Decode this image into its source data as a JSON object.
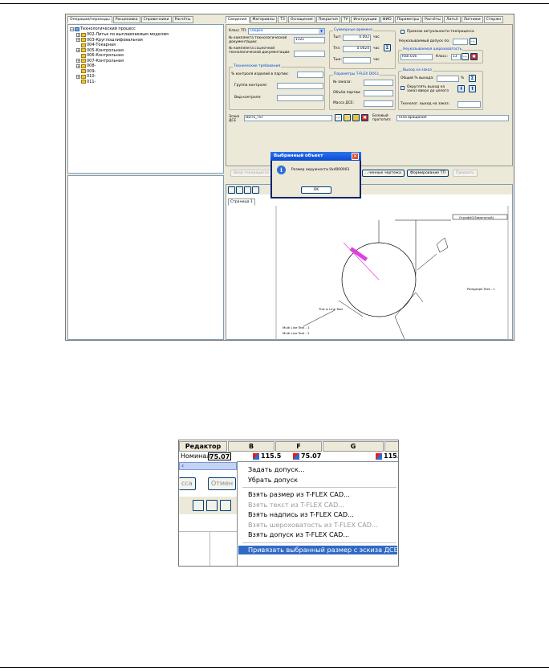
{
  "top_tabs": [
    "Операции/переходы",
    "Расцеховка",
    "Справочники",
    "Расчёты"
  ],
  "tree": {
    "root": "Технологический процесс",
    "items": [
      {
        "label": "002-Литье по выплавляемым моделям",
        "plus": true
      },
      {
        "label": "003-Круглошлифовальная",
        "plus": true
      },
      {
        "label": "004-Токарная",
        "plus": false
      },
      {
        "label": "005-Контрольная",
        "plus": true
      },
      {
        "label": "006-Контрольная",
        "plus": false
      },
      {
        "label": "007-Контрольная",
        "plus": true
      },
      {
        "label": "008-",
        "plus": true
      },
      {
        "label": "009-",
        "plus": false
      },
      {
        "label": "010-",
        "plus": true
      },
      {
        "label": "011-",
        "plus": false
      }
    ]
  },
  "right_tabs": [
    "Сведения",
    "Материалы",
    "ТЗ",
    "Оснащение",
    "Покрытия",
    "ТУ",
    "Инструкции",
    "ФИО",
    "Параметры",
    "Расчёты",
    "Литьё",
    "Литники",
    "Стержн"
  ],
  "form": {
    "class_tp_label": "Класс ТП:",
    "class_tp_value": "Сборка",
    "kit_label": "№ комплекта технологической документации:",
    "kit_value": "1121",
    "ref_kit_label": "№ комплекта ссылочной технологической документации:",
    "tech_req_title": "Технические требования",
    "control_pct_label": "% контроля изделий в партии:",
    "control_group_label": "Группа контроля:",
    "control_type_label": "Вид контроля:",
    "sum_time_title": "Суммарные времена",
    "tsht_label": "Тшт:",
    "tsht_value": "0.002",
    "tsht_unit": "час",
    "tpz_label": "Тпз:",
    "tpz_value": "0.0024",
    "tpz_unit": "час",
    "tshk_label": "Тшк:",
    "tshk_unit": "час",
    "params_title": "Параметры T-FLEX DOCs",
    "order_label": "№ заказа:",
    "batch_label": "Объём партии:",
    "mass_label": "Масса ДСЕ:",
    "relevance_label": "Признак актуальности техпроцесса",
    "tolerance_label": "Неуказываемый допуск по:",
    "roughness_title": "Неуказываемая шероховатость",
    "roughness_value": "Ra0.016",
    "class_label": "Класс:",
    "class_value": "13",
    "output_title": "Выход на заказ",
    "total_pct_label": "Общий % выхода:",
    "pct_unit": "%",
    "round_label": "Округлять выход на заказ вверх до целого",
    "techn_output_label": "Технолог. выход на заказ:",
    "sketch_label": "Эскиз ДСЕ",
    "sketch_value": "DDTk_TST",
    "proto_label": "Базовый прототип:",
    "proto_value": "Тела вращения"
  },
  "bottom_buttons": {
    "enter": "Ввод техпроцесса",
    "drawing": "...ченные чертежа",
    "form_tp": "Формирование ТП",
    "interrupt": "Прервать"
  },
  "page_tab": "Страница 1",
  "drawing_labels": {
    "paragraph": "Paragraph Text - 1",
    "line_text": "This is Line Text",
    "multi1": "Multi Line Text - 1",
    "multi2": "Multi Line Text - 2",
    "note": "Ограф40(Замкнутый)"
  },
  "dialog": {
    "title": "Выбранный объект",
    "message": "Размер окружности 0x4000003",
    "ok": "OK"
  },
  "editor": {
    "header": "Редактор",
    "columns": [
      "B",
      "F",
      "G"
    ],
    "row_label": "Номинал",
    "values": [
      "75.07",
      "115.5",
      "75.07",
      "115."
    ],
    "side_btn_cancel": "Отмен",
    "side_btn_process": "сса"
  },
  "context_menu": [
    {
      "label": "Задать допуск...",
      "disabled": false
    },
    {
      "label": "Убрать допуск",
      "disabled": false
    },
    {
      "sep": true
    },
    {
      "label": "Взять размер из T-FLEX CAD...",
      "disabled": false
    },
    {
      "label": "Взять текст из T-FLEX CAD...",
      "disabled": true
    },
    {
      "label": "Взять надпись из T-FLEX CAD...",
      "disabled": false
    },
    {
      "label": "Взять шероховатость из T-FLEX CAD...",
      "disabled": true
    },
    {
      "label": "Взять допуск из T-FLEX CAD...",
      "disabled": false
    },
    {
      "sep": true
    },
    {
      "label": "Привязать выбранный размер с эскиза ДСЕ",
      "disabled": false,
      "highlighted": true
    }
  ],
  "colors": {
    "highlight": "#316ac5",
    "titlebar": "#0a4bd0",
    "magenta": "#e040e0"
  }
}
